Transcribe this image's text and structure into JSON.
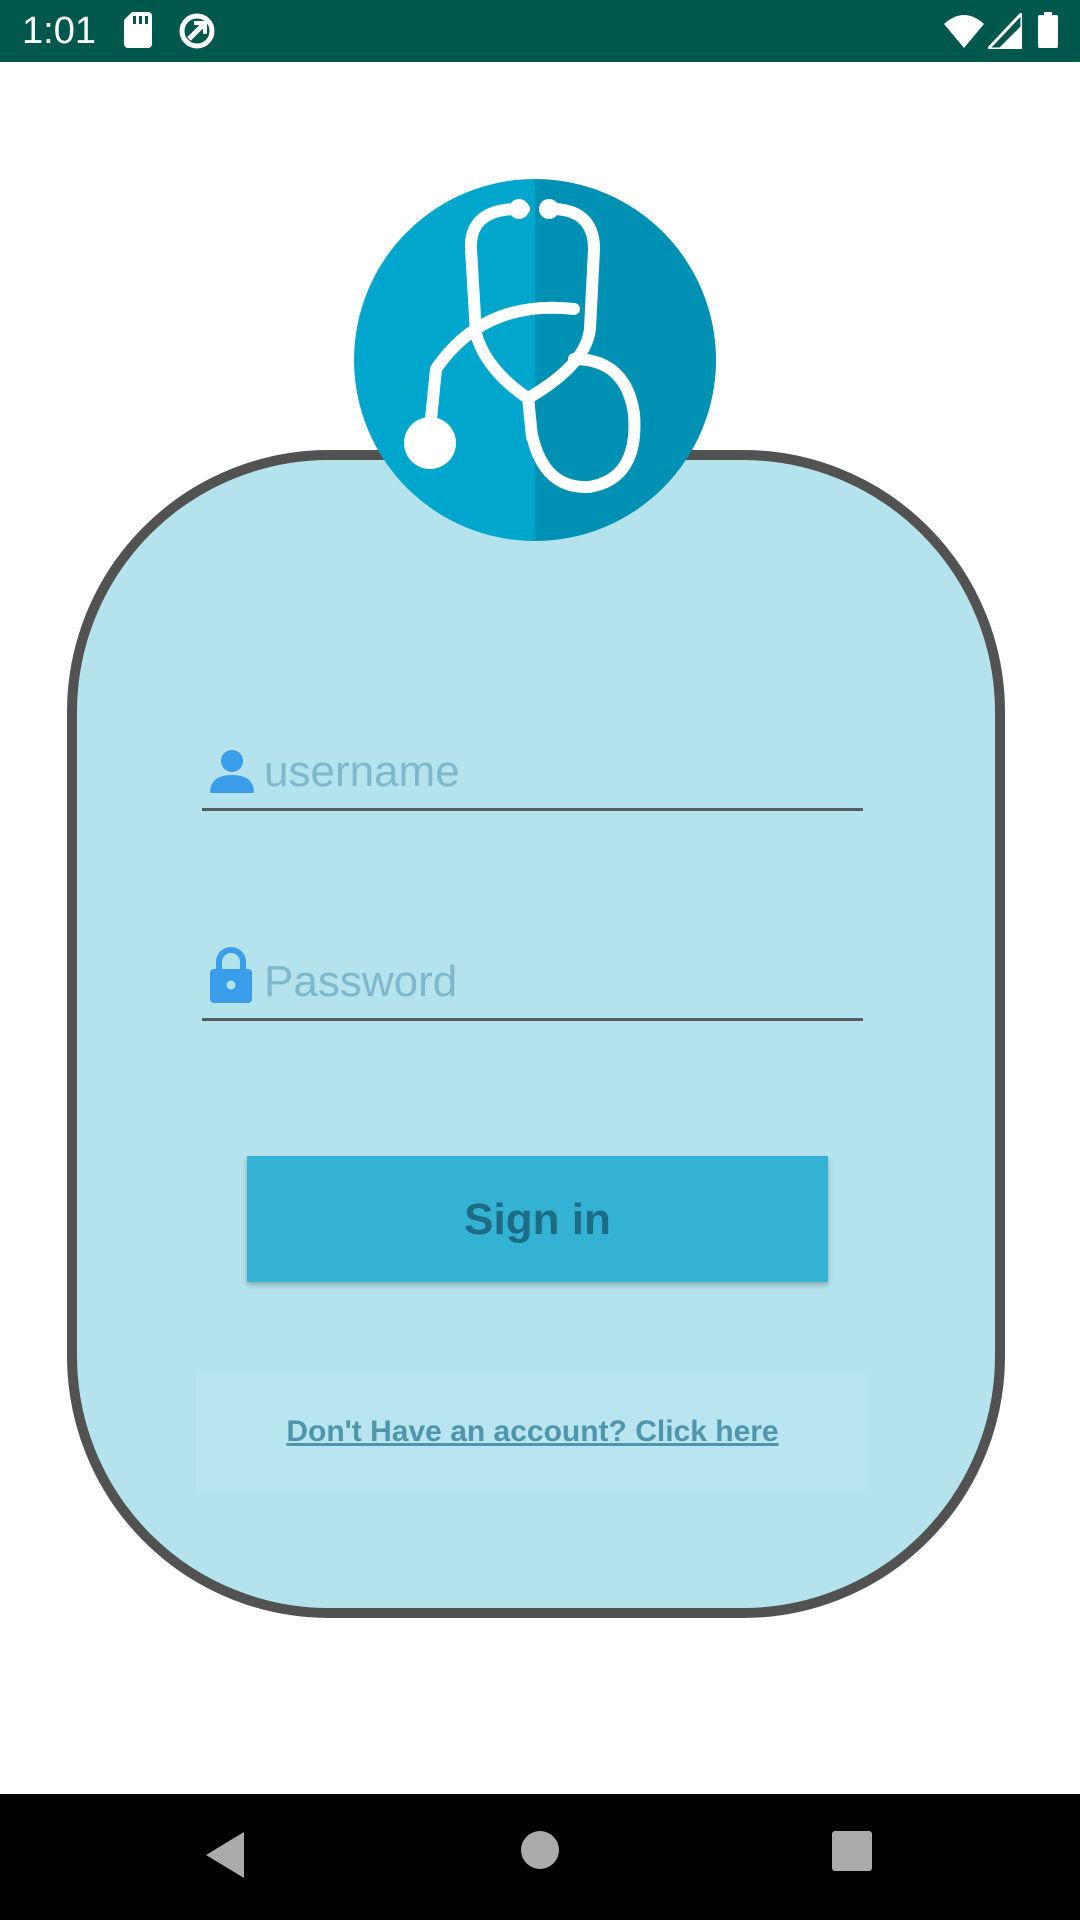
{
  "status_bar": {
    "time": "1:01",
    "icons": [
      "sd-card-icon",
      "sync-icon",
      "wifi-icon",
      "cell-signal-icon",
      "battery-icon"
    ]
  },
  "logo": {
    "icon": "stethoscope-icon"
  },
  "login": {
    "username_placeholder": "username",
    "username_value": "",
    "password_placeholder": "Password",
    "password_value": "",
    "signin_label": "Sign in",
    "register_link": "Don't Have an account? Click here"
  },
  "nav_bar": {
    "icons": [
      "back-icon",
      "home-icon",
      "recents-icon"
    ]
  },
  "colors": {
    "status_bar": "#00574b",
    "card_background": "#b4e3ee",
    "card_border": "#525252",
    "button": "#33b2d3",
    "button_text": "#1d6b84",
    "field_icon": "#3a9dea",
    "link_text": "#4f95ac",
    "logo_light": "#00a6cb",
    "logo_dark": "#0090b3"
  }
}
